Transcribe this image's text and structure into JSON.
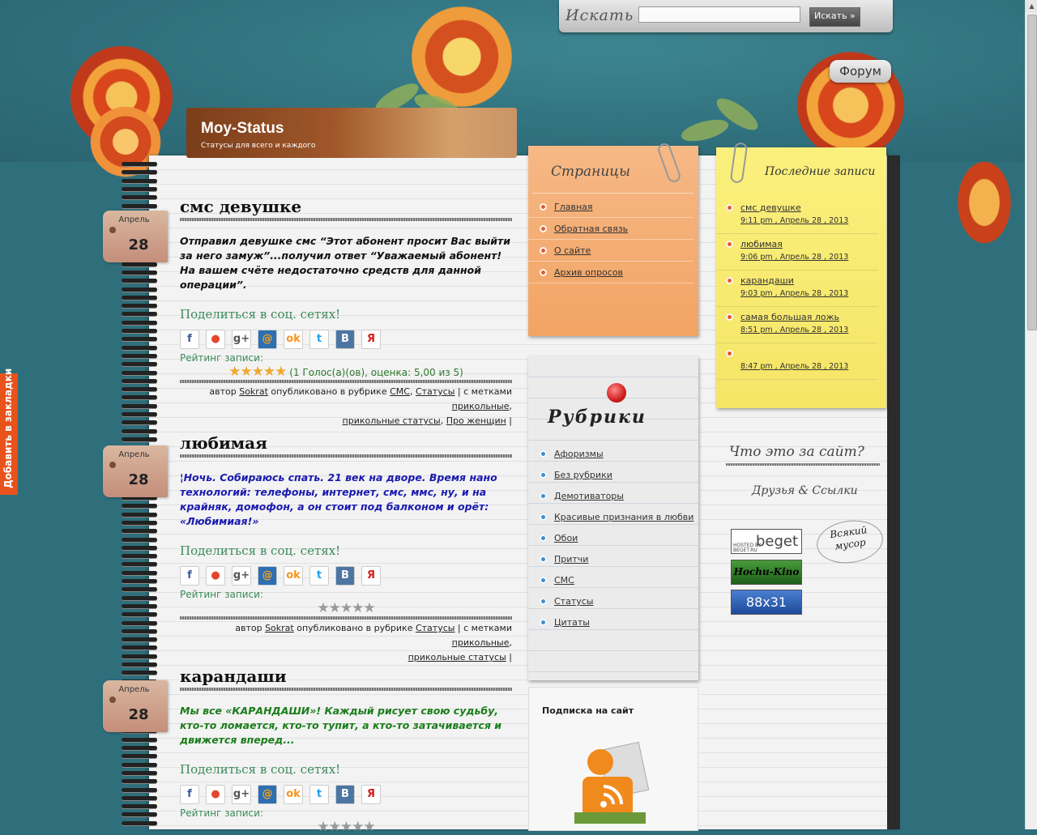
{
  "header": {
    "site_title": "Moy-Status",
    "tagline": "Статусы для всего и каждого",
    "search_label": "Искать",
    "search_value": "",
    "search_button": "Искать »",
    "forum_button": "Форум"
  },
  "bookmark_tab": "Добавить в закладки",
  "posts": [
    {
      "title": "смс девушке",
      "month": "Апрель",
      "day": "28",
      "text": "Отправил девушке смс “Этот абонент просит Вас выйти за него замуж”...получил ответ “Уважаемый абонент! На вашем счёте недостаточно средств для данной операции”.",
      "text_color": "#111111",
      "share_label": "Поделиться в соц. сетях!",
      "rating_label": "Рейтинг записи:",
      "stars": 5,
      "rating_text": "(1 Голос(а)(ов), оценка: 5,00 из 5)",
      "meta_line1_pre": "автор ",
      "author": "Sokrat",
      "meta_line1_mid": " опубликовано в рубрике ",
      "cat1": "СМС",
      "cat_sep": ", ",
      "cat2": "Статусы",
      "meta_tags_label": " | с метками ",
      "tag1": "прикольные",
      "meta_end1": ",",
      "tag2": "прикольные статусы",
      "tag_sep": ", ",
      "tag3": "Про женщин",
      "meta_end": " |"
    },
    {
      "title": "любимая",
      "month": "Апрель",
      "day": "28",
      "text": "¦Ночь. Собираюсь спать. 21 век на дворе. Время нано технологий: телефоны, интернет, смс, ммс, ну, и на крайняк, домофон, а он стоит под балконом и орёт: «Любимиая!»",
      "text_color": "#1a1ab0",
      "share_label": "Поделиться в соц. сетях!",
      "rating_label": "Рейтинг записи:",
      "stars": 0,
      "meta_line1_pre": "автор ",
      "author": "Sokrat",
      "meta_line1_mid": " опубликовано в рубрике ",
      "cat1": "Статусы",
      "meta_tags_label": " | с метками ",
      "tag1": "прикольные",
      "meta_end1": ",",
      "tag2": "прикольные статусы",
      "meta_end": " |"
    },
    {
      "title": "карандаши",
      "month": "Апрель",
      "day": "28",
      "text": "Мы все «КАРАНДАШИ»! Каждый рисует свою судьбу, кто-то ломается, кто-то тупит, а кто-то затачивается и движется вперед...",
      "text_color": "#1a7d1a",
      "share_label": "Поделиться в соц. сетях!",
      "rating_label": "Рейтинг записи:",
      "stars": 0
    }
  ],
  "share_icons": [
    {
      "name": "facebook-icon",
      "glyph": "f",
      "bg": "#ffffff",
      "fg": "#3b5998"
    },
    {
      "name": "chat-bubbles-icon",
      "glyph": "●",
      "bg": "#ffffff",
      "fg": "#e2462c"
    },
    {
      "name": "google-plus-icon",
      "glyph": "g+",
      "bg": "#ffffff",
      "fg": "#555555"
    },
    {
      "name": "mail-ru-icon",
      "glyph": "@",
      "bg": "#2d6fb3",
      "fg": "#f7a21b"
    },
    {
      "name": "odnoklassniki-icon",
      "glyph": "ok",
      "bg": "#ffffff",
      "fg": "#f7931e"
    },
    {
      "name": "twitter-icon",
      "glyph": "t",
      "bg": "#ffffff",
      "fg": "#1da1f2"
    },
    {
      "name": "vkontakte-icon",
      "glyph": "B",
      "bg": "#4c75a3",
      "fg": "#ffffff"
    },
    {
      "name": "yandex-icon",
      "glyph": "Я",
      "bg": "#ffffff",
      "fg": "#d51f1f"
    }
  ],
  "pages_widget": {
    "heading": "Страницы",
    "items": [
      "Главная",
      "Обратная связь",
      "О сайте",
      "Архив опросов"
    ]
  },
  "categories_widget": {
    "heading": "Рубрики",
    "items": [
      "Афоризмы",
      "Без рубрики",
      "Демотиваторы",
      "Красивые признания в любви",
      "Обои",
      "Притчи",
      "СМС",
      "Статусы",
      "Цитаты"
    ]
  },
  "subscribe_widget": {
    "title": "Подписка на сайт"
  },
  "recent_widget": {
    "heading": "Последние записи",
    "items": [
      {
        "title": "смс девушке",
        "when": "9:11 pm , Апрель 28 , 2013"
      },
      {
        "title": "любимая",
        "when": "9:06 pm , Апрель 28 , 2013"
      },
      {
        "title": "карандаши",
        "when": "9:03 pm , Апрель 28 , 2013"
      },
      {
        "title": "самая большая ложь",
        "when": "8:51 pm , Апрель 28 , 2013"
      },
      {
        "title": "",
        "when": "8:47 pm , Апрель 28 , 2013"
      }
    ]
  },
  "about_heading": "Что это за сайт?",
  "friends_heading": "Друзья & Ссылки",
  "banners": {
    "beget": "beget",
    "beget_sub": "HOSTED BY BEGET.RU",
    "kino": "Hochu-Kino",
    "button_8831": "88x31",
    "junk": "Всякий мусор"
  },
  "colors": {
    "background": "#2f6f7c",
    "accent_orange": "#e8531c",
    "link_green": "#3a8a5a"
  }
}
